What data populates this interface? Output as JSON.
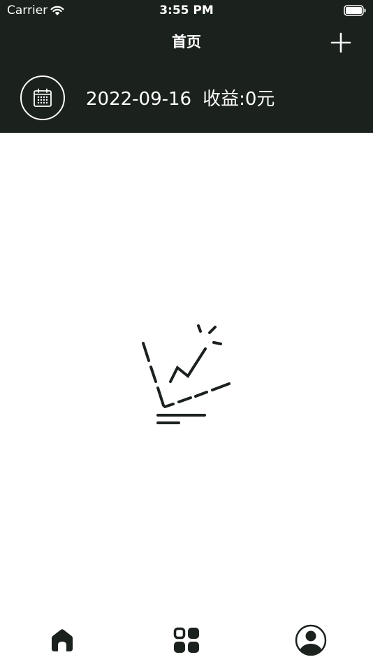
{
  "status_bar": {
    "carrier": "Carrier",
    "time": "3:55 PM"
  },
  "nav": {
    "title": "首页",
    "add_icon": "plus-icon"
  },
  "summary": {
    "date": "2022-09-16",
    "income_label": "收益:0元",
    "calendar_icon": "calendar-icon"
  },
  "empty_state": {
    "icon": "line-chart-illustration"
  },
  "tab_bar": {
    "items": [
      {
        "icon": "home-icon",
        "active": true
      },
      {
        "icon": "grid-icon",
        "active": false
      },
      {
        "icon": "user-icon",
        "active": false
      }
    ]
  },
  "colors": {
    "header_bg": "#1b211d",
    "header_text": "#ffffff",
    "icon_dark": "#1b211d",
    "page_bg": "#ffffff"
  }
}
